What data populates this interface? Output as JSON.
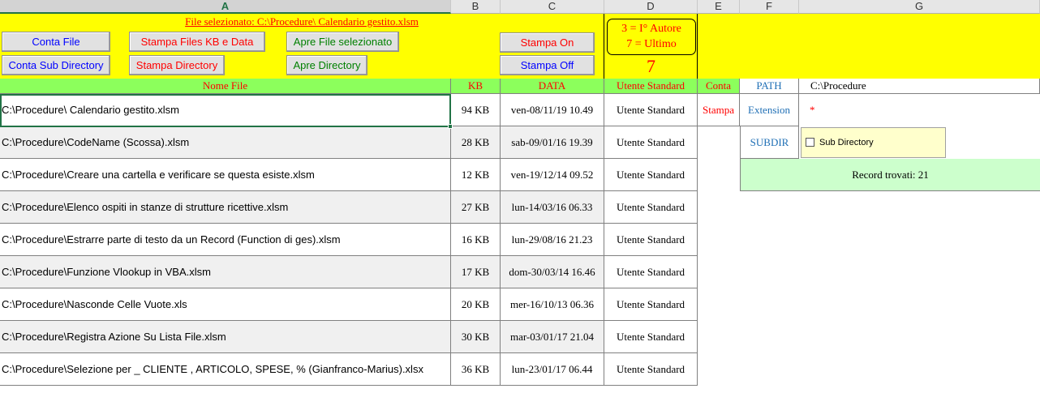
{
  "column_headers": [
    "A",
    "B",
    "C",
    "D",
    "E",
    "F",
    "G"
  ],
  "selected_file_label": "File selezionato: C:\\Procedure\\ Calendario gestito.xlsm",
  "buttons": {
    "conta_file": "Conta File",
    "conta_subdir": "Conta  Sub Directory",
    "stampa_files_kb": "Stampa Files KB e Data",
    "stampa_directory": "Stampa Directory",
    "apre_file": "Apre File selezionato",
    "apre_directory": "Apre Directory",
    "stampa_on": "Stampa On",
    "stampa_off": "Stampa Off"
  },
  "info_box": {
    "line1": "3 = I° Autore",
    "line2": "7 = Ultimo",
    "value": "7"
  },
  "headers": {
    "nome_file": "Nome File",
    "kb": "KB",
    "data": "DATA",
    "utente": "Utente Standard",
    "conta": "Conta",
    "path": "PATH",
    "path_value": "C:\\Procedure"
  },
  "side": {
    "stampa": "Stampa",
    "extension": "Extension",
    "extension_value": "*",
    "subdir": "SUBDIR",
    "subdir_checkbox": "Sub  Directory",
    "records": "Record trovati: 21"
  },
  "rows": [
    {
      "name": "C:\\Procedure\\ Calendario gestito.xlsm",
      "kb": "94 KB",
      "date": "ven-08/11/19 10.49",
      "user": "Utente Standard"
    },
    {
      "name": "C:\\Procedure\\CodeName (Scossa).xlsm",
      "kb": "28 KB",
      "date": "sab-09/01/16 19.39",
      "user": "Utente Standard"
    },
    {
      "name": "C:\\Procedure\\Creare una cartella e verificare se questa esiste.xlsm",
      "kb": "12 KB",
      "date": "ven-19/12/14 09.52",
      "user": "Utente Standard"
    },
    {
      "name": "C:\\Procedure\\Elenco ospiti in stanze di strutture ricettive.xlsm",
      "kb": "27 KB",
      "date": "lun-14/03/16 06.33",
      "user": "Utente Standard"
    },
    {
      "name": "C:\\Procedure\\Estrarre parte di testo da un Record (Function di ges).xlsm",
      "kb": "16 KB",
      "date": "lun-29/08/16 21.23",
      "user": "Utente Standard"
    },
    {
      "name": "C:\\Procedure\\Funzione Vlookup in VBA.xlsm",
      "kb": "17 KB",
      "date": "dom-30/03/14 16.46",
      "user": "Utente Standard"
    },
    {
      "name": "C:\\Procedure\\Nasconde Celle Vuote.xls",
      "kb": "20 KB",
      "date": "mer-16/10/13 06.36",
      "user": "Utente Standard"
    },
    {
      "name": "C:\\Procedure\\Registra Azione Su Lista File.xlsm",
      "kb": "30 KB",
      "date": "mar-03/01/17 21.04",
      "user": "Utente Standard"
    },
    {
      "name": "C:\\Procedure\\Selezione per _ CLIENTE , ARTICOLO, SPESE, % (Gianfranco-Marius).xlsx",
      "kb": "36 KB",
      "date": "lun-23/01/17 06.44",
      "user": "Utente Standard"
    }
  ]
}
